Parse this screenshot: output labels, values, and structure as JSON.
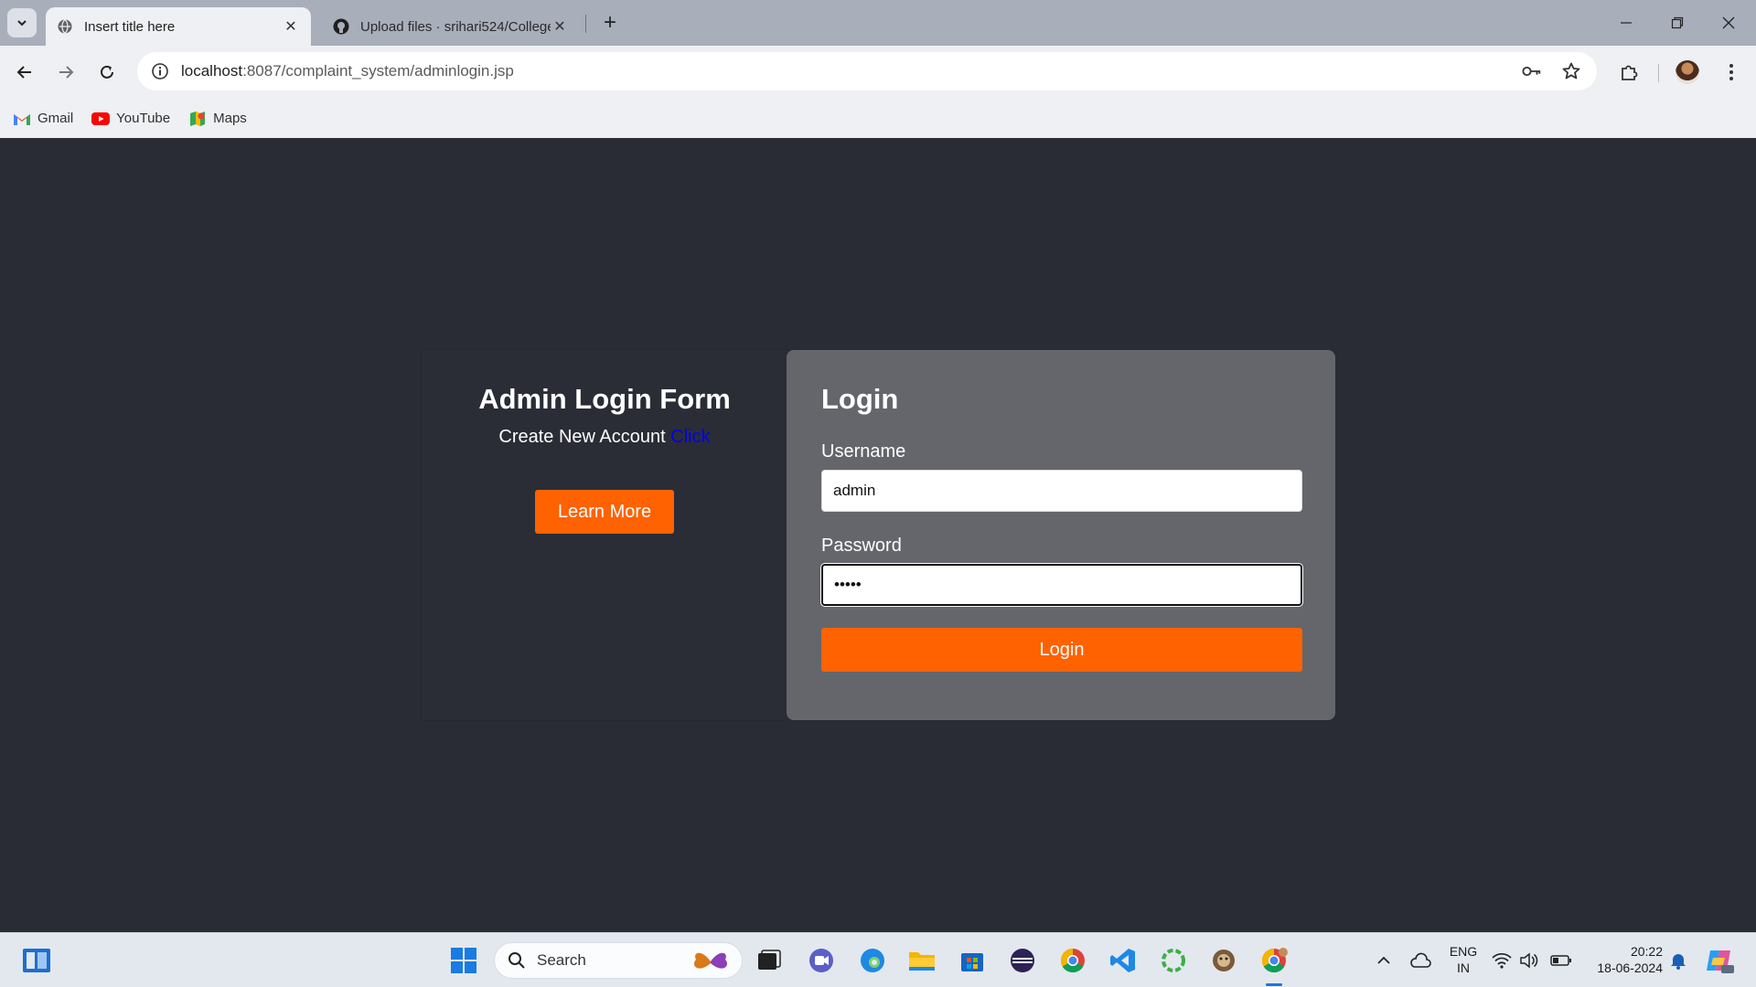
{
  "browser": {
    "tabs": [
      {
        "title": "Insert title here",
        "active": true
      },
      {
        "title": "Upload files · srihari524/College",
        "active": false
      }
    ],
    "url": {
      "host": "localhost",
      "path": ":8087/complaint_system/adminlogin.jsp"
    },
    "bookmarks": [
      {
        "label": "Gmail",
        "icon": "gmail-icon"
      },
      {
        "label": "YouTube",
        "icon": "youtube-icon"
      },
      {
        "label": "Maps",
        "icon": "maps-icon"
      }
    ]
  },
  "left_panel": {
    "title": "Admin Login Form",
    "create_text": "Create New Account",
    "create_link": "Click",
    "learn_more": "Learn More"
  },
  "login_form": {
    "heading": "Login",
    "username_label": "Username",
    "username_value": "admin",
    "password_label": "Password",
    "password_value": "•••••",
    "submit_label": "Login"
  },
  "taskbar": {
    "search_placeholder": "Search",
    "language": "ENG",
    "region": "IN",
    "time": "20:22",
    "date": "18-06-2024"
  },
  "colors": {
    "accent": "#ff6200",
    "page_bg": "#292c35",
    "form_panel": "#64666b",
    "link": "#0000ee"
  }
}
